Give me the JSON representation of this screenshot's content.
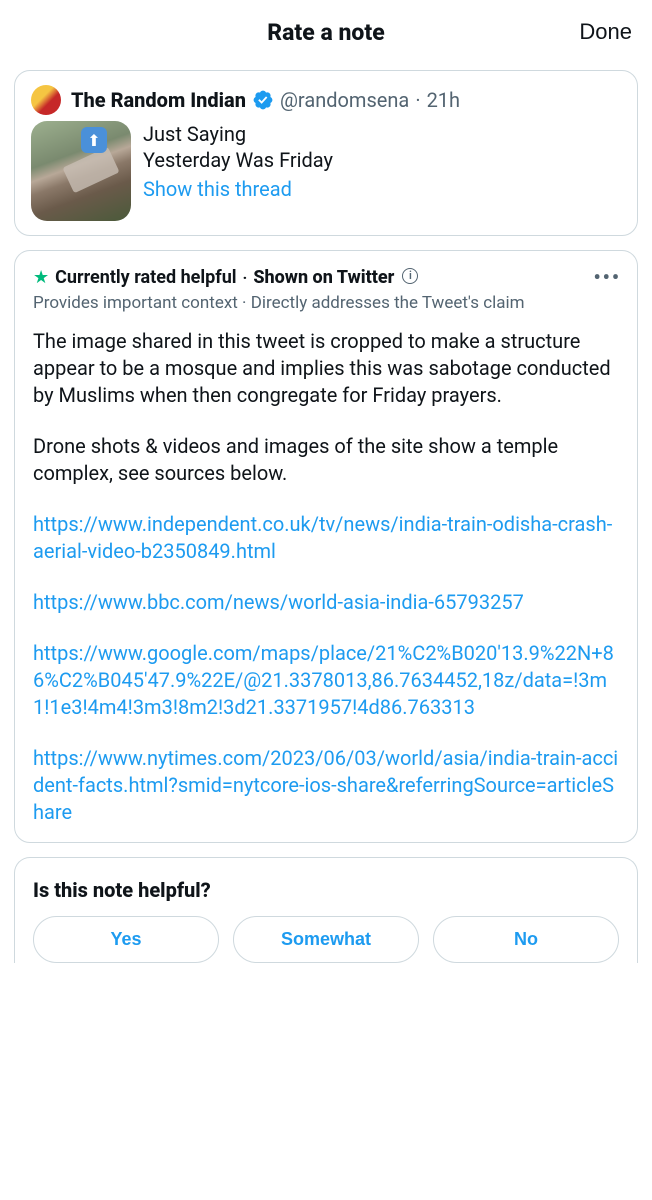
{
  "header": {
    "title": "Rate a note",
    "done": "Done"
  },
  "tweet": {
    "display_name": "The Random Indian",
    "handle": "@randomsena",
    "separator": "·",
    "time": "21h",
    "line1": "Just Saying",
    "line2": "Yesterday Was Friday",
    "show_thread": "Show this thread"
  },
  "note": {
    "status_helpful": "Currently rated helpful",
    "status_separator": "·",
    "status_shown": "Shown on Twitter",
    "subheader": "Provides important context · Directly addresses the Tweet's claim",
    "para1": "The image shared in this tweet is cropped to make a structure appear to be a mosque and implies this was sabotage conducted by Muslims when then congregate for Friday prayers.",
    "para2": "Drone shots & videos and images of the site show a temple complex, see sources below.",
    "link1": "https://www.independent.co.uk/tv/news/india-train-odisha-crash-aerial-video-b2350849.html",
    "link2": "https://www.bbc.com/news/world-asia-india-65793257",
    "link3": "https://www.google.com/maps/place/21%C2%B020'13.9%22N+86%C2%B045'47.9%22E/@21.3378013,86.7634452,18z/data=!3m1!1e3!4m4!3m3!8m2!3d21.3371957!4d86.763313",
    "link4": "https://www.nytimes.com/2023/06/03/world/asia/india-train-accident-facts.html?smid=nytcore-ios-share&referringSource=articleShare"
  },
  "feedback": {
    "question": "Is this note helpful?",
    "yes": "Yes",
    "somewhat": "Somewhat",
    "no": "No"
  }
}
